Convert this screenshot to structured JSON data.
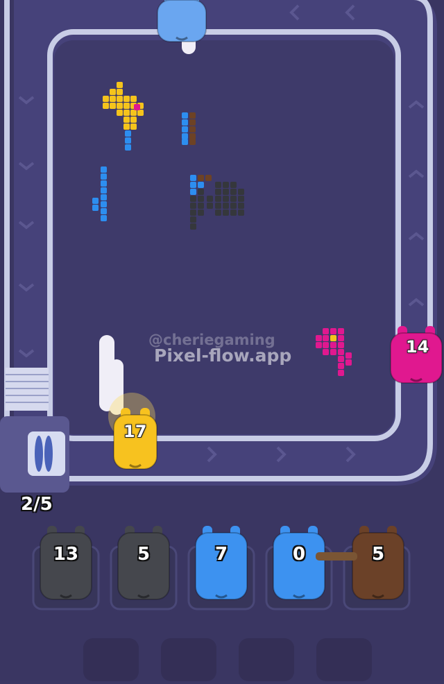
{
  "watermark": {
    "handle": "@cheriegaming",
    "site": "Pixel-flow.app"
  },
  "level_progress": "2/5",
  "belt_shooters": [
    {
      "color": "#f7c21f",
      "count": "17"
    },
    {
      "color": "#e0188f",
      "count": "14"
    }
  ],
  "queue": [
    {
      "color": "#45474d",
      "count": "13"
    },
    {
      "color": "#45474d",
      "count": "5"
    },
    {
      "color": "#3d92f0",
      "count": "7"
    },
    {
      "color": "#3d92f0",
      "count": "0"
    },
    {
      "color": "#6b4128",
      "count": "5"
    }
  ],
  "pixel_art_colors": {
    "yellow": "#f5c41c",
    "blue": "#2d8ef0",
    "brown": "#6d4225",
    "black": "#35373c",
    "magenta": "#e0188f"
  },
  "colors": {
    "background": "#3b3763",
    "board": "#3f3b6a",
    "belt_rail": "#c9cee8",
    "belt_track": "#4a4678"
  }
}
